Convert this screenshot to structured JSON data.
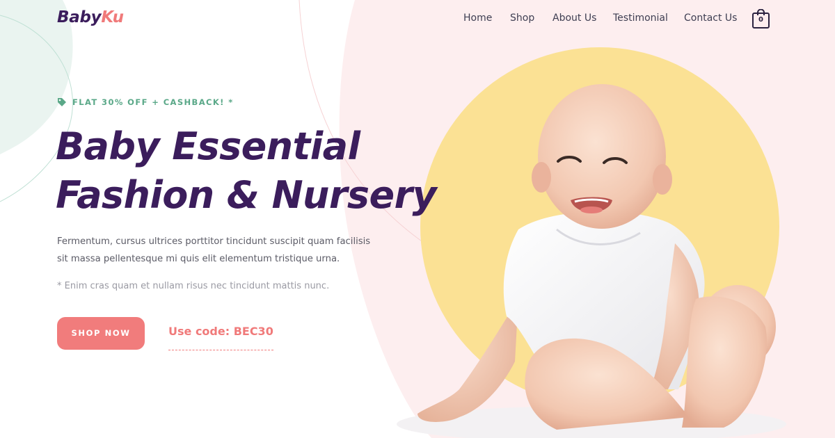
{
  "brand": {
    "part1": "Baby",
    "part2": "Ku",
    "colors": {
      "primary": "#3b1d5c",
      "accent": "#f07a7a",
      "green": "#5aa888",
      "yellow": "#fbe194",
      "pink_bg": "#fdeeef"
    }
  },
  "nav": {
    "items": [
      {
        "label": "Home"
      },
      {
        "label": "Shop"
      },
      {
        "label": "About Us"
      },
      {
        "label": "Testimonial"
      },
      {
        "label": "Contact Us"
      }
    ],
    "cart_count": "0",
    "cart_icon": "shopping-bag-icon"
  },
  "hero": {
    "promo_icon": "tag-icon",
    "promo": "FLAT 30% OFF + CASHBACK! *",
    "headline_line1": "Baby Essential",
    "headline_line2": "Fashion & Nursery",
    "description": "Fermentum, cursus ultrices porttitor tincidunt suscipit quam facilisis sit massa pellentesque mi quis elit elementum tristique urna.",
    "note": "* Enim cras quam et nullam risus nec tincidunt mattis nunc.",
    "button_label": "SHOP NOW",
    "code_text": "Use code: BEC30"
  }
}
